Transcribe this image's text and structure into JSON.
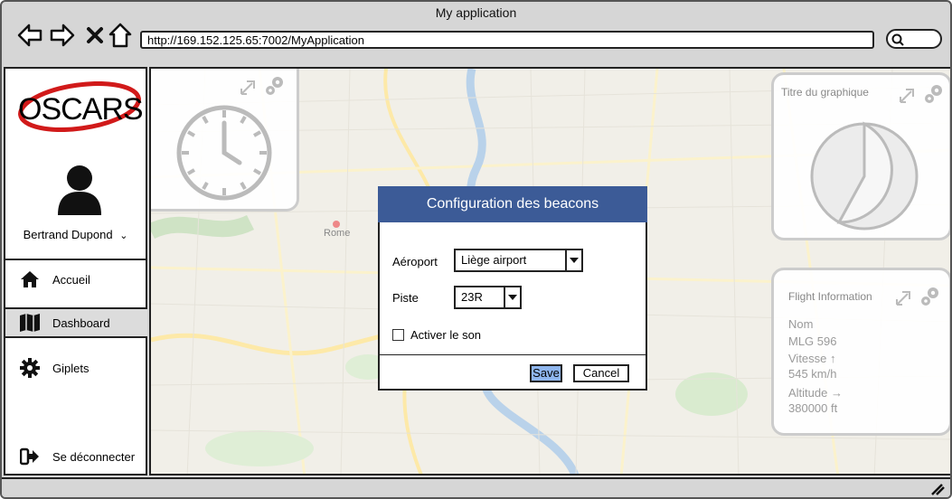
{
  "window": {
    "title": "My application",
    "url": "http://169.152.125.65:7002/MyApplication"
  },
  "sidebar": {
    "logo_text": "OSCARS",
    "user_name": "Bertrand Dupond",
    "items": [
      {
        "label": "Accueil",
        "icon": "home-icon"
      },
      {
        "label": "Dashboard",
        "icon": "map-icon"
      },
      {
        "label": "Giplets",
        "icon": "gear-icon"
      }
    ],
    "logout_label": "Se déconnecter"
  },
  "map_labels": {
    "city": "Rome"
  },
  "widgets": {
    "chart": {
      "title": "Titre du graphique"
    },
    "flight": {
      "title": "Flight Information",
      "nom_label": "Nom",
      "nom_value": "MLG 596",
      "vitesse_label": "Vitesse",
      "vitesse_value": "545 km/h",
      "altitude_label": "Altitude",
      "altitude_value": "380000 ft"
    }
  },
  "dialog": {
    "title": "Configuration des beacons",
    "aeroport_label": "Aéroport",
    "aeroport_value": "Liège airport",
    "piste_label": "Piste",
    "piste_value": "23R",
    "sound_label": "Activer le son",
    "save_label": "Save",
    "cancel_label": "Cancel"
  },
  "colors": {
    "dialog_header": "#3c5b97",
    "save_button": "#8fb6ee",
    "logo_ring": "#d11a1a"
  }
}
